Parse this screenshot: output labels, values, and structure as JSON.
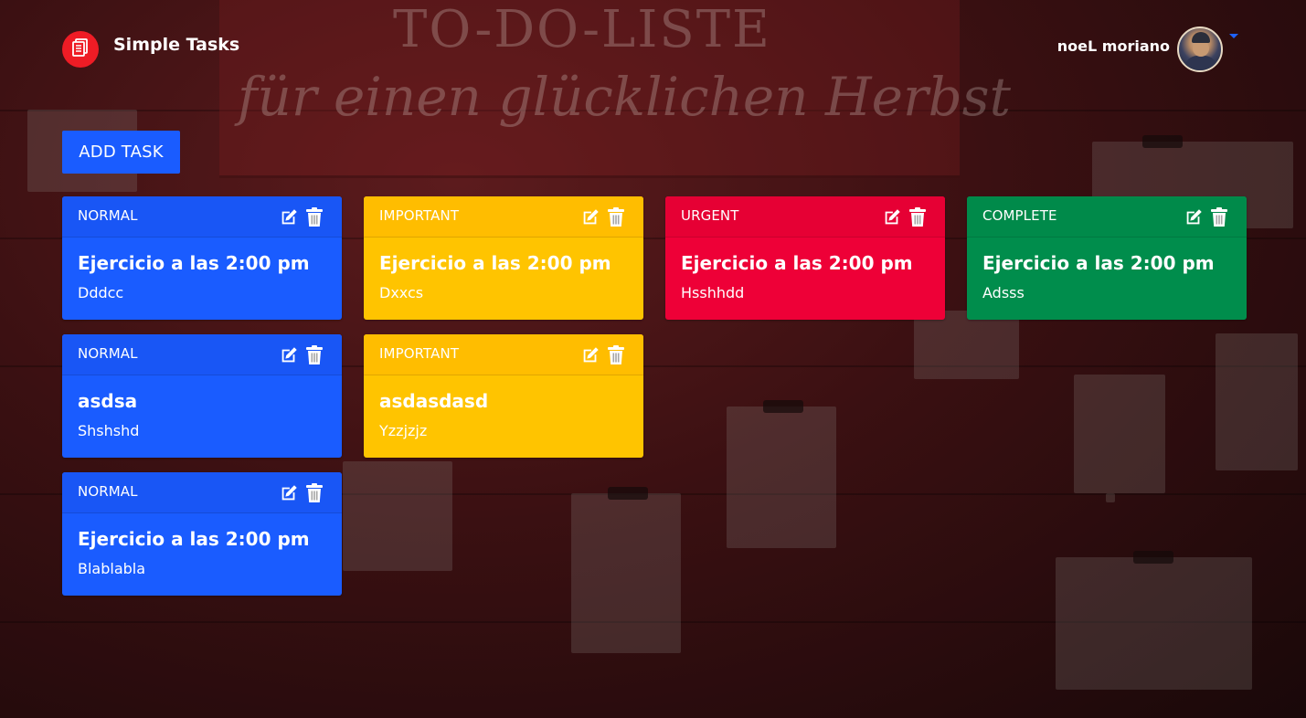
{
  "header": {
    "brand": "Simple Tasks",
    "user_name": "noeL moriano",
    "logo_icon": "task-list-icon"
  },
  "actions": {
    "add_task": "ADD TASK"
  },
  "colors": {
    "normal": "#1a5cff",
    "important": "#ffc400",
    "urgent": "#ee0037",
    "complete": "#008d4c"
  },
  "cards": [
    {
      "status": "NORMAL",
      "title": "Ejercicio a las 2:00 pm",
      "description": "Dddcc"
    },
    {
      "status": "IMPORTANT",
      "title": "Ejercicio a las 2:00 pm",
      "description": "Dxxcs"
    },
    {
      "status": "URGENT",
      "title": "Ejercicio a las 2:00 pm",
      "description": "Hsshhdd"
    },
    {
      "status": "COMPLETE",
      "title": "Ejercicio a las 2:00 pm",
      "description": "Adsss"
    },
    {
      "status": "NORMAL",
      "title": "asdsa",
      "description": "Shshshd"
    },
    {
      "status": "IMPORTANT",
      "title": "asdasdasd",
      "description": "Yzzjzjz"
    },
    {
      "status": "NORMAL",
      "title": "Ejercicio a las 2:00 pm",
      "description": "Blablabla"
    }
  ],
  "background": {
    "board_title": "TO-DO-LISTE",
    "board_subtitle": "für einen glücklichen Herbst"
  }
}
